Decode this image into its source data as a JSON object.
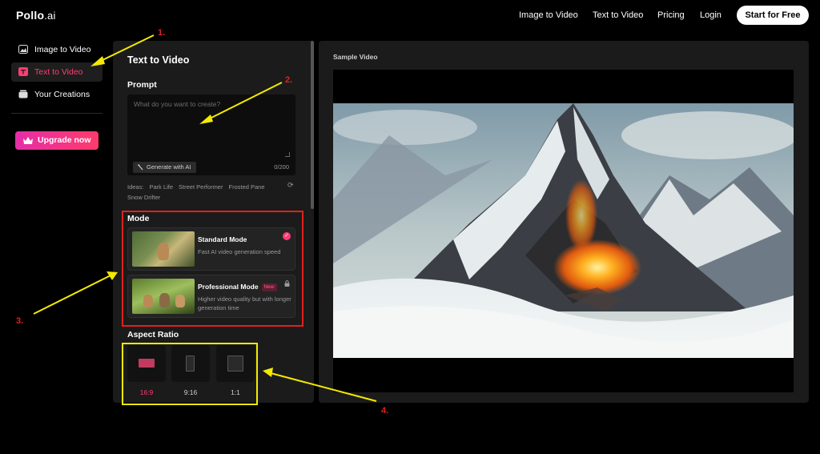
{
  "nav": {
    "logo_main": "Pollo",
    "logo_suffix": ".ai",
    "links": [
      "Image to Video",
      "Text to Video",
      "Pricing",
      "Login"
    ],
    "cta": "Start for Free"
  },
  "sidebar": {
    "items": [
      {
        "label": "Image to Video",
        "icon": "image-icon"
      },
      {
        "label": "Text to Video",
        "icon": "text-video-icon",
        "active": true
      },
      {
        "label": "Your Creations",
        "icon": "creations-icon"
      }
    ],
    "upgrade": "Upgrade now"
  },
  "form": {
    "title": "Text to Video",
    "prompt_label": "Prompt",
    "prompt_placeholder": "What do you want to create?",
    "generate_ai": "Generate with AI",
    "counter": "0/200",
    "ideas_label": "Ideas:",
    "ideas": [
      "Park Life",
      "Street Performer",
      "Frosted Pane",
      "Snow Drifter"
    ],
    "mode_label": "Mode",
    "modes": [
      {
        "name": "Standard Mode",
        "desc": "Fast AI video generation speed",
        "selected": true
      },
      {
        "name": "Professional Mode",
        "badge": "New",
        "desc": "Higher video quality but with longer generation time",
        "locked": true
      }
    ],
    "aspect_label": "Aspect Ratio",
    "ratios": [
      {
        "label": "16:9",
        "active": true
      },
      {
        "label": "9:16"
      },
      {
        "label": "1:1"
      }
    ]
  },
  "video": {
    "title": "Sample Video"
  },
  "annotations": [
    "1.",
    "2.",
    "3.",
    "4."
  ],
  "colors": {
    "accent": "#ff3d74",
    "annotation_red": "#e0211e",
    "annotation_yellow": "#f5ea00"
  }
}
